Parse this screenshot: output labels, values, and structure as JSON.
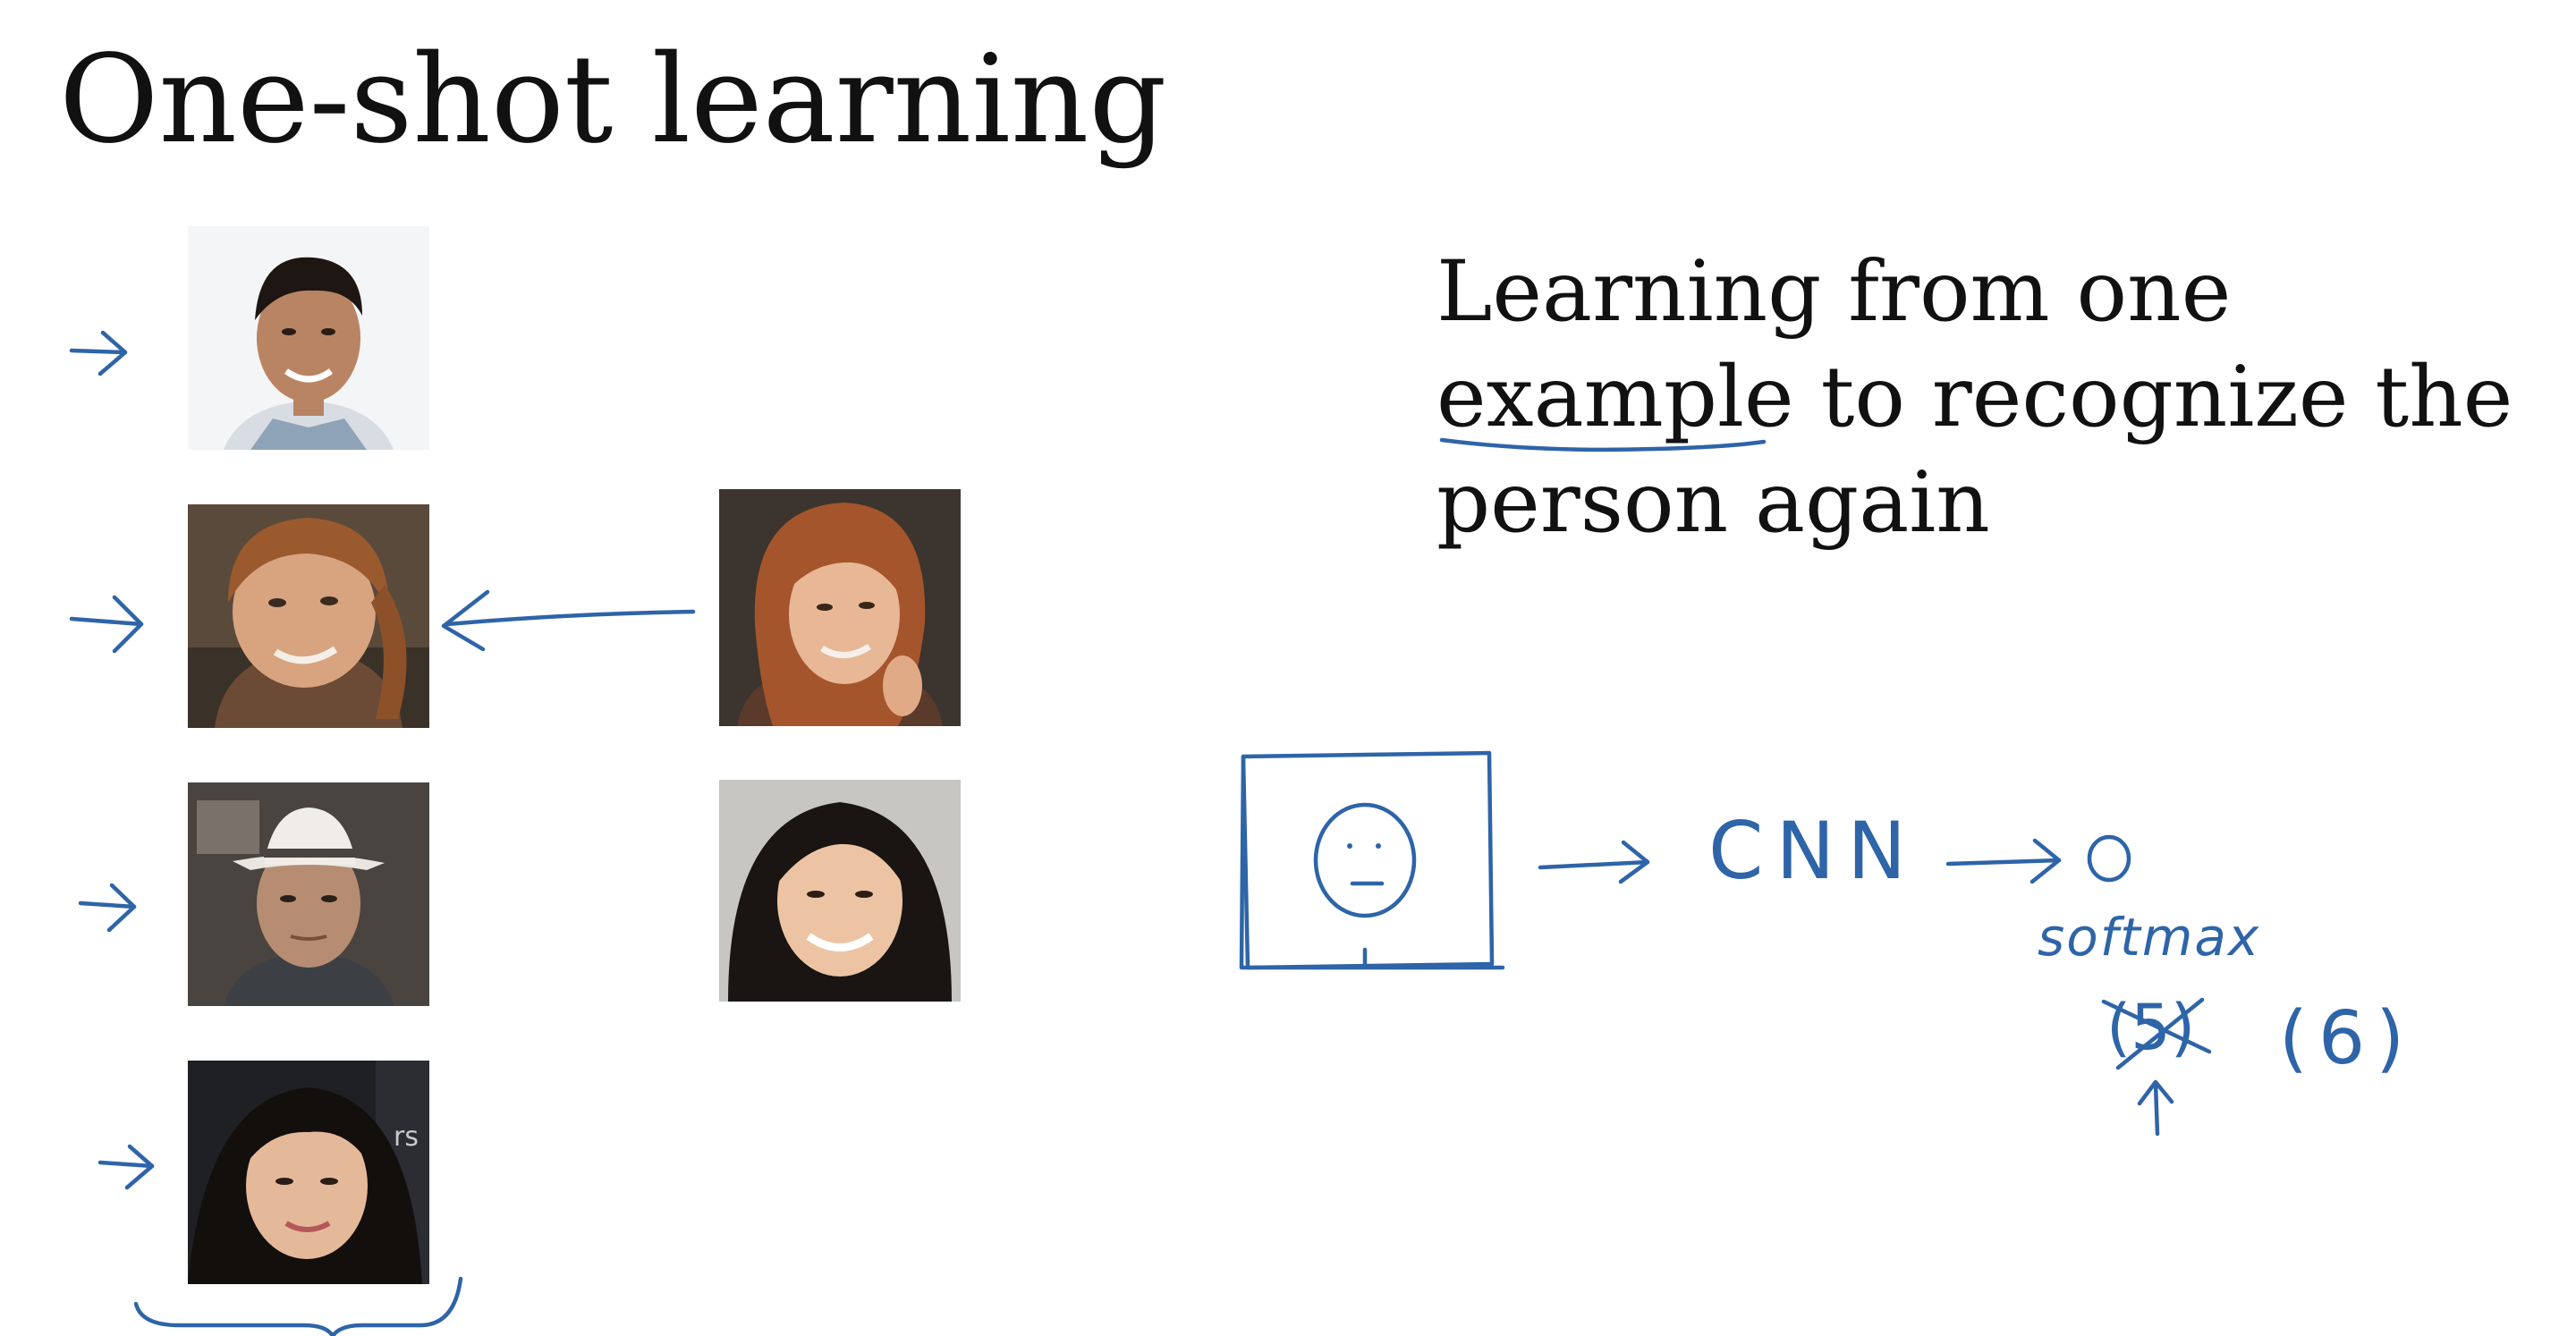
{
  "slide": {
    "title": "One-shot learning",
    "definition_lines": [
      "Learning from one",
      "example to recognize the",
      "person again"
    ]
  },
  "photos": {
    "database": [
      "face photo 1",
      "face photo 2",
      "face photo 3",
      "face photo 4"
    ],
    "query": "query face photo",
    "other": "other face photo"
  },
  "annotations": {
    "cnn": "CNN",
    "softmax": "softmax",
    "crossed_out": "(5)",
    "replacement": "(6)",
    "ink_color": "#2e64a8"
  }
}
